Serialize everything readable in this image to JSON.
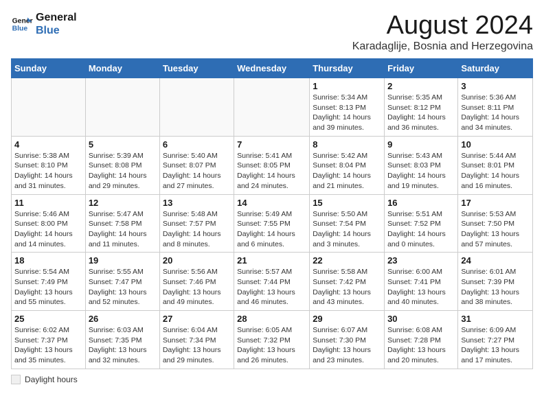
{
  "logo": {
    "line1": "General",
    "line2": "Blue"
  },
  "title": "August 2024",
  "location": "Karadaglije, Bosnia and Herzegovina",
  "days_of_week": [
    "Sunday",
    "Monday",
    "Tuesday",
    "Wednesday",
    "Thursday",
    "Friday",
    "Saturday"
  ],
  "legend_label": "Daylight hours",
  "weeks": [
    [
      {
        "day": "",
        "info": ""
      },
      {
        "day": "",
        "info": ""
      },
      {
        "day": "",
        "info": ""
      },
      {
        "day": "",
        "info": ""
      },
      {
        "day": "1",
        "info": "Sunrise: 5:34 AM\nSunset: 8:13 PM\nDaylight: 14 hours and 39 minutes."
      },
      {
        "day": "2",
        "info": "Sunrise: 5:35 AM\nSunset: 8:12 PM\nDaylight: 14 hours and 36 minutes."
      },
      {
        "day": "3",
        "info": "Sunrise: 5:36 AM\nSunset: 8:11 PM\nDaylight: 14 hours and 34 minutes."
      }
    ],
    [
      {
        "day": "4",
        "info": "Sunrise: 5:38 AM\nSunset: 8:10 PM\nDaylight: 14 hours and 31 minutes."
      },
      {
        "day": "5",
        "info": "Sunrise: 5:39 AM\nSunset: 8:08 PM\nDaylight: 14 hours and 29 minutes."
      },
      {
        "day": "6",
        "info": "Sunrise: 5:40 AM\nSunset: 8:07 PM\nDaylight: 14 hours and 27 minutes."
      },
      {
        "day": "7",
        "info": "Sunrise: 5:41 AM\nSunset: 8:05 PM\nDaylight: 14 hours and 24 minutes."
      },
      {
        "day": "8",
        "info": "Sunrise: 5:42 AM\nSunset: 8:04 PM\nDaylight: 14 hours and 21 minutes."
      },
      {
        "day": "9",
        "info": "Sunrise: 5:43 AM\nSunset: 8:03 PM\nDaylight: 14 hours and 19 minutes."
      },
      {
        "day": "10",
        "info": "Sunrise: 5:44 AM\nSunset: 8:01 PM\nDaylight: 14 hours and 16 minutes."
      }
    ],
    [
      {
        "day": "11",
        "info": "Sunrise: 5:46 AM\nSunset: 8:00 PM\nDaylight: 14 hours and 14 minutes."
      },
      {
        "day": "12",
        "info": "Sunrise: 5:47 AM\nSunset: 7:58 PM\nDaylight: 14 hours and 11 minutes."
      },
      {
        "day": "13",
        "info": "Sunrise: 5:48 AM\nSunset: 7:57 PM\nDaylight: 14 hours and 8 minutes."
      },
      {
        "day": "14",
        "info": "Sunrise: 5:49 AM\nSunset: 7:55 PM\nDaylight: 14 hours and 6 minutes."
      },
      {
        "day": "15",
        "info": "Sunrise: 5:50 AM\nSunset: 7:54 PM\nDaylight: 14 hours and 3 minutes."
      },
      {
        "day": "16",
        "info": "Sunrise: 5:51 AM\nSunset: 7:52 PM\nDaylight: 14 hours and 0 minutes."
      },
      {
        "day": "17",
        "info": "Sunrise: 5:53 AM\nSunset: 7:50 PM\nDaylight: 13 hours and 57 minutes."
      }
    ],
    [
      {
        "day": "18",
        "info": "Sunrise: 5:54 AM\nSunset: 7:49 PM\nDaylight: 13 hours and 55 minutes."
      },
      {
        "day": "19",
        "info": "Sunrise: 5:55 AM\nSunset: 7:47 PM\nDaylight: 13 hours and 52 minutes."
      },
      {
        "day": "20",
        "info": "Sunrise: 5:56 AM\nSunset: 7:46 PM\nDaylight: 13 hours and 49 minutes."
      },
      {
        "day": "21",
        "info": "Sunrise: 5:57 AM\nSunset: 7:44 PM\nDaylight: 13 hours and 46 minutes."
      },
      {
        "day": "22",
        "info": "Sunrise: 5:58 AM\nSunset: 7:42 PM\nDaylight: 13 hours and 43 minutes."
      },
      {
        "day": "23",
        "info": "Sunrise: 6:00 AM\nSunset: 7:41 PM\nDaylight: 13 hours and 40 minutes."
      },
      {
        "day": "24",
        "info": "Sunrise: 6:01 AM\nSunset: 7:39 PM\nDaylight: 13 hours and 38 minutes."
      }
    ],
    [
      {
        "day": "25",
        "info": "Sunrise: 6:02 AM\nSunset: 7:37 PM\nDaylight: 13 hours and 35 minutes."
      },
      {
        "day": "26",
        "info": "Sunrise: 6:03 AM\nSunset: 7:35 PM\nDaylight: 13 hours and 32 minutes."
      },
      {
        "day": "27",
        "info": "Sunrise: 6:04 AM\nSunset: 7:34 PM\nDaylight: 13 hours and 29 minutes."
      },
      {
        "day": "28",
        "info": "Sunrise: 6:05 AM\nSunset: 7:32 PM\nDaylight: 13 hours and 26 minutes."
      },
      {
        "day": "29",
        "info": "Sunrise: 6:07 AM\nSunset: 7:30 PM\nDaylight: 13 hours and 23 minutes."
      },
      {
        "day": "30",
        "info": "Sunrise: 6:08 AM\nSunset: 7:28 PM\nDaylight: 13 hours and 20 minutes."
      },
      {
        "day": "31",
        "info": "Sunrise: 6:09 AM\nSunset: 7:27 PM\nDaylight: 13 hours and 17 minutes."
      }
    ]
  ]
}
